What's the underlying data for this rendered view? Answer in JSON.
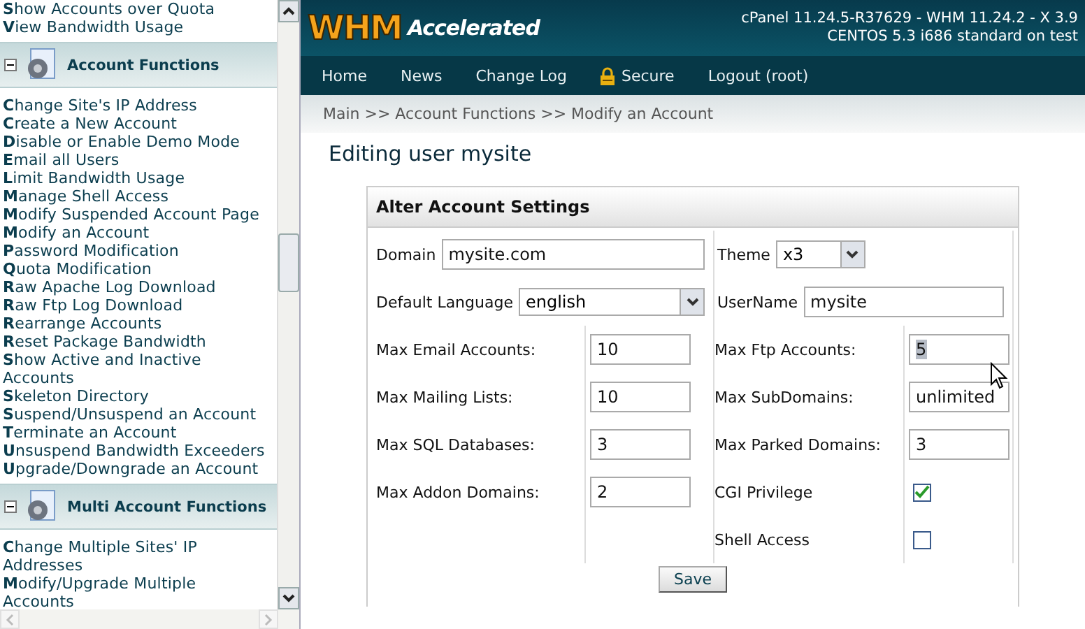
{
  "sidebar": {
    "top_items": [
      "Show Accounts over Quota",
      "View Bandwidth Usage"
    ],
    "groups": [
      {
        "title": "Account Functions",
        "expanded": true,
        "items": [
          "Change Site's IP Address",
          "Create a New Account",
          "Disable or Enable Demo Mode",
          "Email all Users",
          "Limit Bandwidth Usage",
          "Manage Shell Access",
          "Modify Suspended Account Page",
          "Modify an Account",
          "Password Modification",
          "Quota Modification",
          "Raw Apache Log Download",
          "Raw Ftp Log Download",
          "Rearrange Accounts",
          "Reset Package Bandwidth",
          "Show Active and Inactive Accounts",
          "Skeleton Directory",
          "Suspend/Unsuspend an Account",
          "Terminate an Account",
          "Unsuspend Bandwidth Exceeders",
          "Upgrade/Downgrade an Account"
        ]
      },
      {
        "title": "Multi Account Functions",
        "expanded": true,
        "items": [
          "Change Multiple Sites' IP Addresses",
          "Modify/Upgrade Multiple Accounts"
        ]
      }
    ]
  },
  "header": {
    "logo_main": "WHM",
    "logo_sub": "Accelerated",
    "version_lines": [
      "cPanel 11.24.5-R37629 - WHM 11.24.2 - X 3.9",
      "CENTOS 5.3 i686 standard on test"
    ]
  },
  "nav": [
    {
      "label": "Home",
      "secure": false
    },
    {
      "label": "News",
      "secure": false
    },
    {
      "label": "Change Log",
      "secure": false
    },
    {
      "label": "Secure",
      "secure": true
    },
    {
      "label": "Logout (root)",
      "secure": false
    }
  ],
  "breadcrumb": "Main >> Account Functions >> Modify an Account",
  "page_title": "Editing user mysite",
  "form": {
    "title": "Alter Account Settings",
    "top_rows": [
      [
        {
          "label": "Domain",
          "kind": "input",
          "value": "mysite.com"
        },
        {
          "label": "Theme",
          "kind": "select",
          "value": "x3"
        }
      ],
      [
        {
          "label": "Default Language",
          "kind": "select",
          "value": "english"
        },
        {
          "label": "UserName",
          "kind": "input",
          "value": "mysite"
        }
      ]
    ],
    "left": [
      {
        "label": "Max Email Accounts:",
        "value": "10"
      },
      {
        "label": "Max Mailing Lists:",
        "value": "10"
      },
      {
        "label": "Max SQL Databases:",
        "value": "3"
      },
      {
        "label": "Max Addon Domains:",
        "value": "2"
      }
    ],
    "right": [
      {
        "label": "Max Ftp Accounts:",
        "kind": "input",
        "value": "5",
        "selected": true
      },
      {
        "label": "Max SubDomains:",
        "kind": "input",
        "value": "unlimited",
        "selected": false
      },
      {
        "label": "Max Parked Domains:",
        "kind": "input",
        "value": "3",
        "selected": false
      },
      {
        "label": "CGI Privilege",
        "kind": "checkbox",
        "checked": true
      },
      {
        "label": "Shell Access",
        "kind": "checkbox",
        "checked": false
      }
    ],
    "button": "Save"
  }
}
